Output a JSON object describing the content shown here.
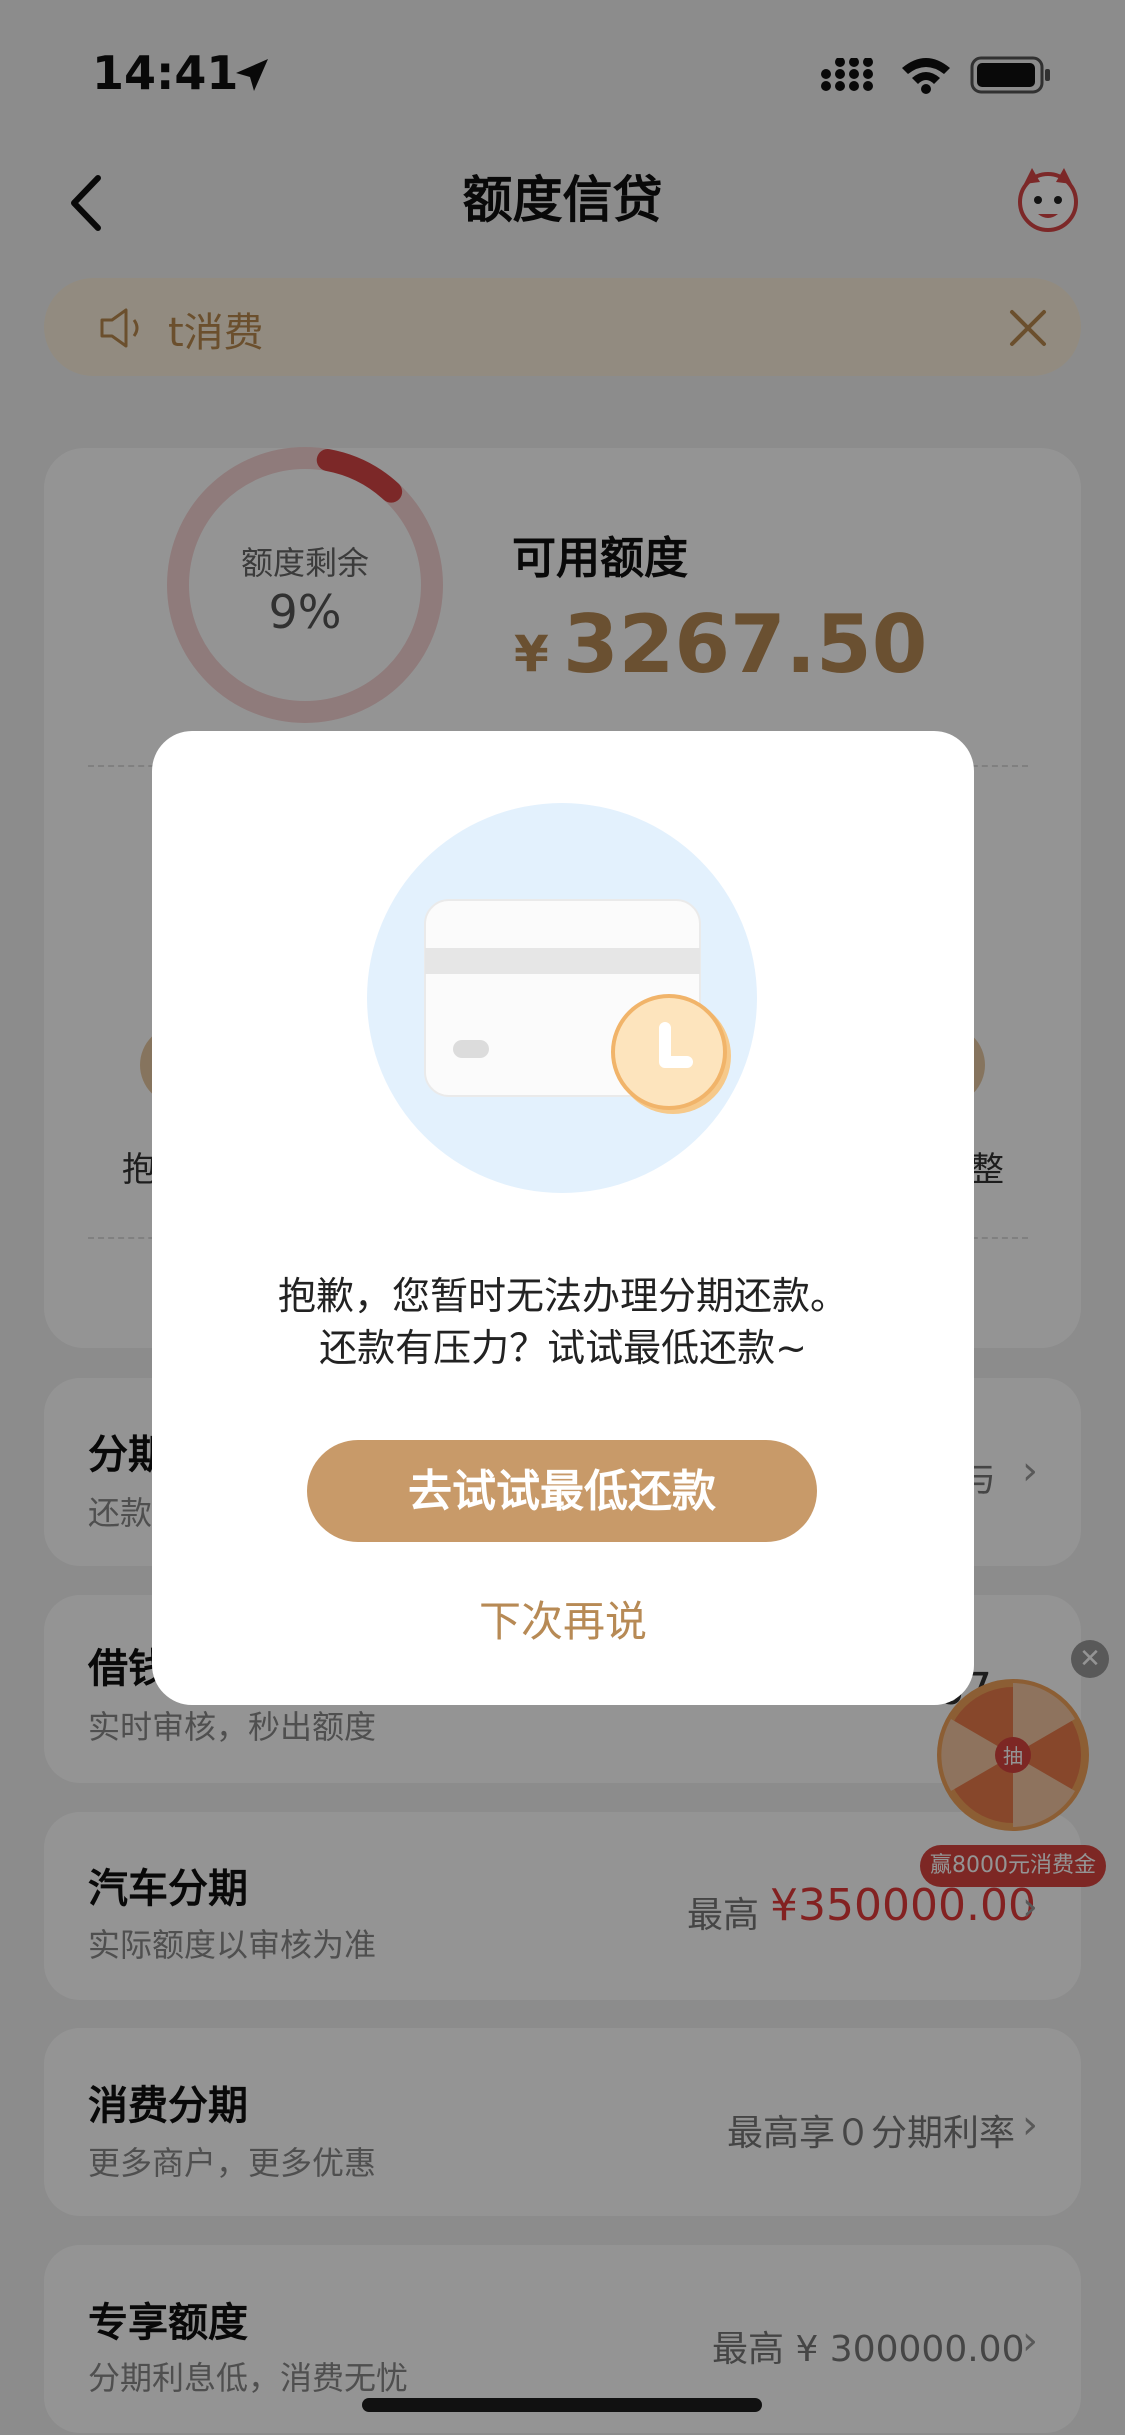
{
  "status_bar": {
    "time": "14:41"
  },
  "header": {
    "title": "额度信贷"
  },
  "notice": {
    "text": "t消费"
  },
  "credit": {
    "ring_label": "额度剩余",
    "ring_value": "9%",
    "ring_fraction": 0.09,
    "available_label": "可用额度",
    "currency": "¥",
    "available_amount": "3267.50",
    "left_action_label": "抱",
    "right_action_label": "整"
  },
  "rows": [
    {
      "title": "分期",
      "subtitle": "还款",
      "right": "与"
    },
    {
      "title": "借钱",
      "subtitle": "实时审核，秒出额度",
      "right": "7267"
    },
    {
      "title": "汽车分期",
      "subtitle": "实际额度以审核为准",
      "right_prefix": "最高",
      "right_amount": "¥350000.00"
    },
    {
      "title": "消费分期",
      "subtitle": "更多商户，更多优惠",
      "right": "最高享０分期利率"
    },
    {
      "title": "专享额度",
      "subtitle": "分期利息低，消费无忧",
      "right": "最高 ¥ 300000.00"
    }
  ],
  "wheel": {
    "center_char": "抽",
    "banner": "赢8000元消费金"
  },
  "modal": {
    "message_line1": "抱歉，您暂时无法办理分期还款。",
    "message_line2": "还款有压力？试试最低还款~",
    "primary_button": "去试试最低还款",
    "secondary_button": "下次再说"
  },
  "colors": {
    "accent": "#c89a69",
    "gold_text": "#b78a55",
    "ring_red": "#d64545",
    "amount_red": "#e23a3a"
  }
}
